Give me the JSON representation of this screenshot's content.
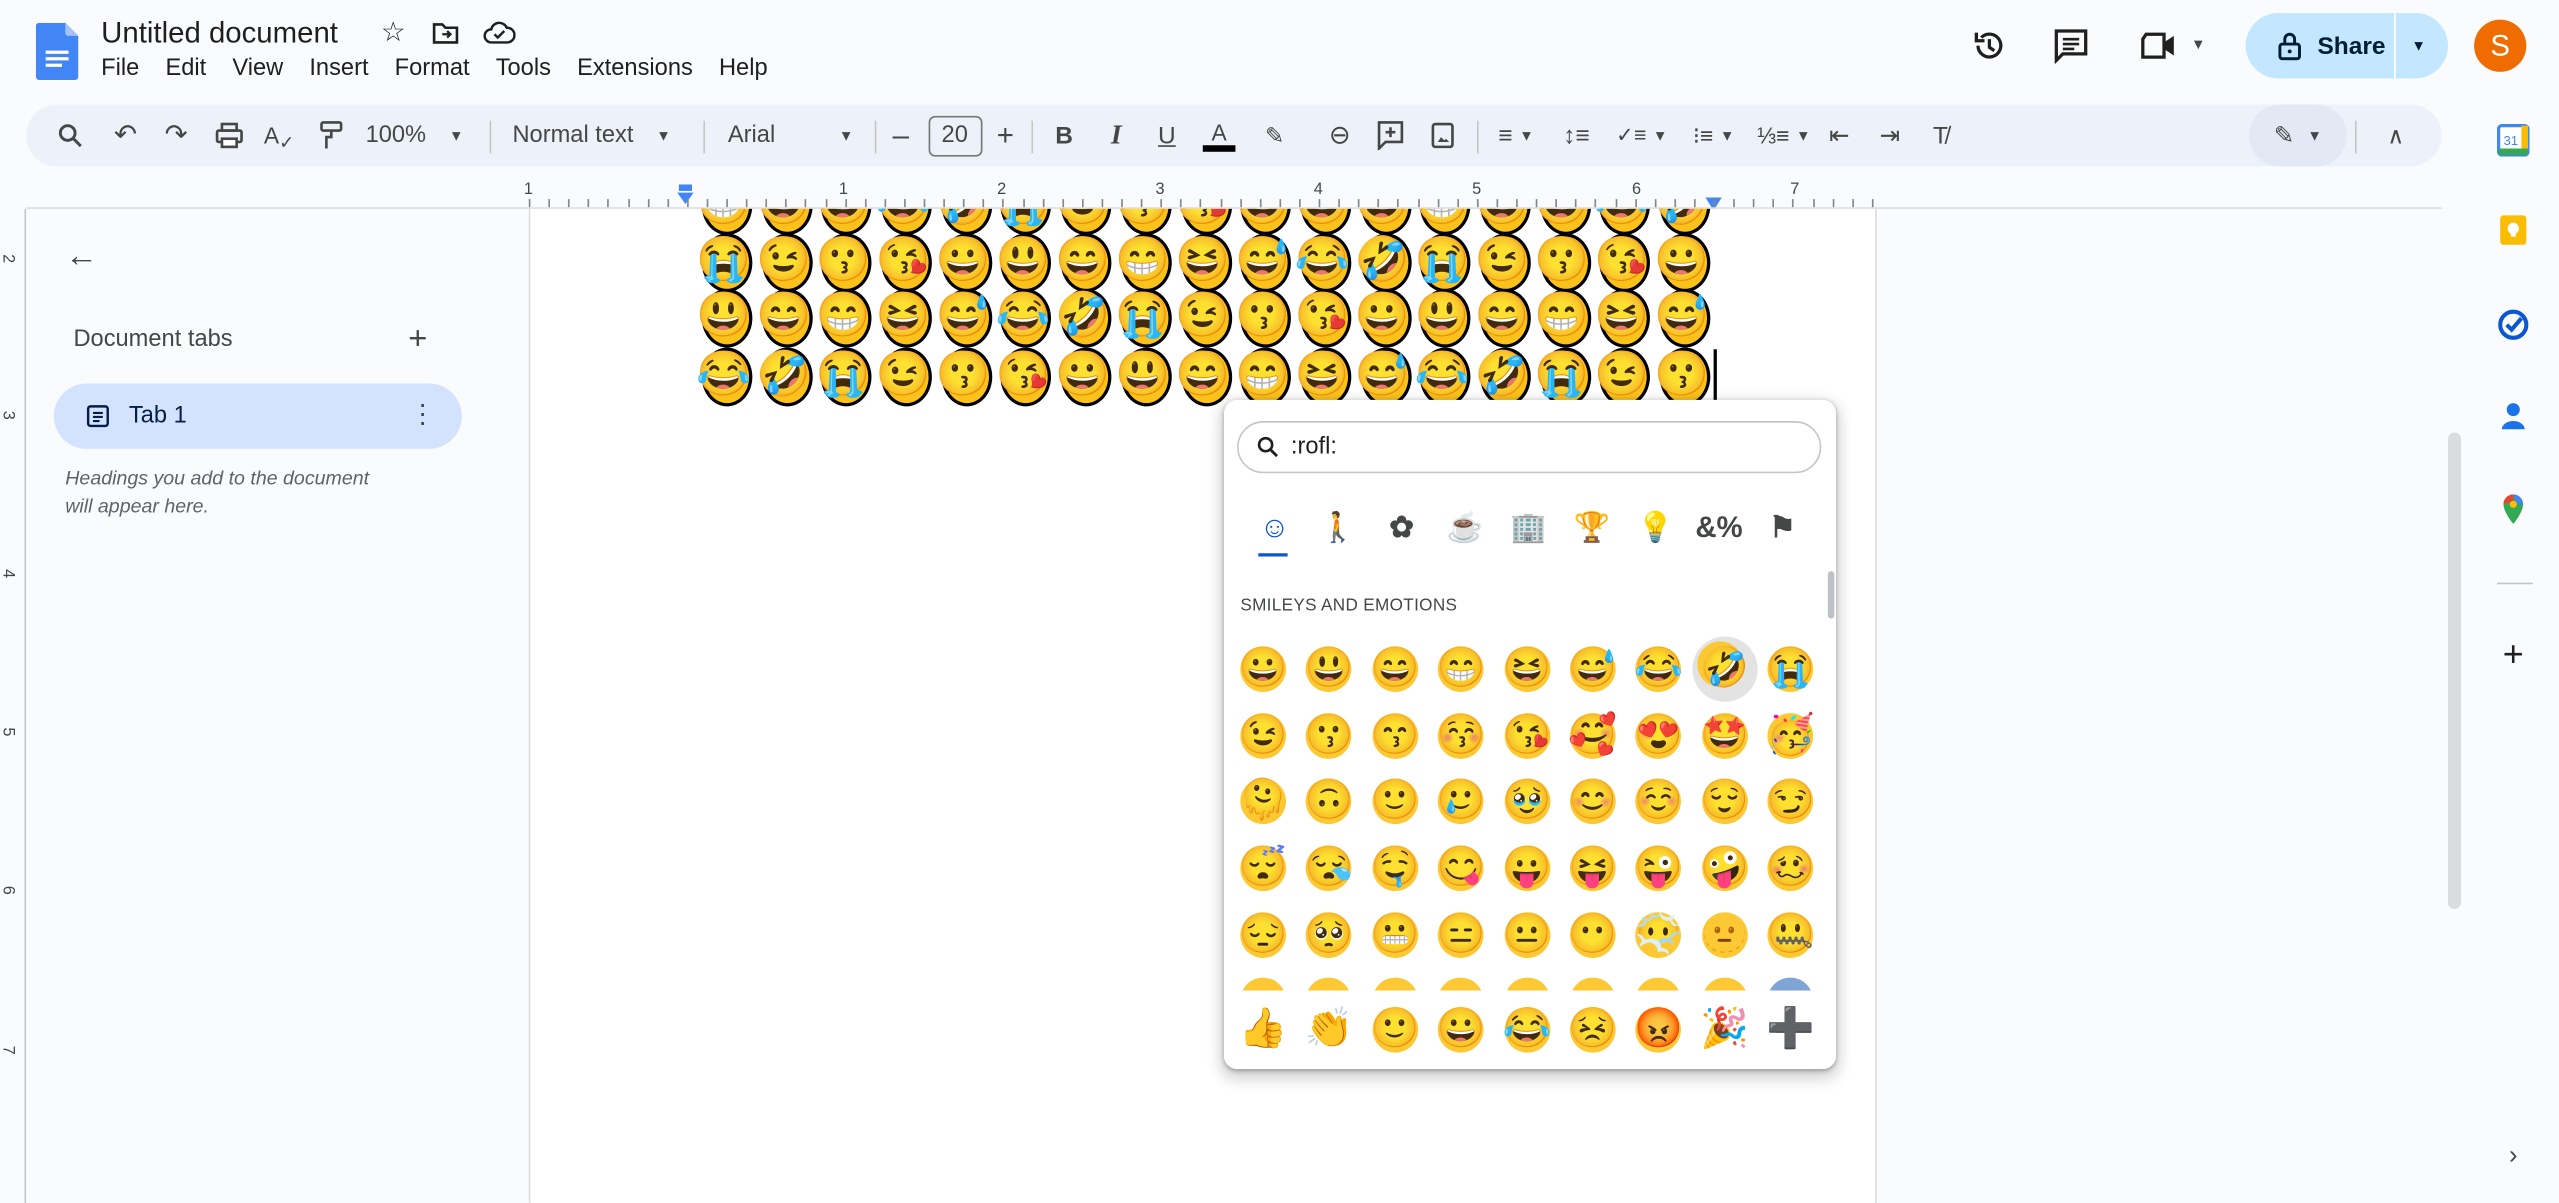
{
  "header": {
    "title": "Untitled document",
    "menu": [
      "File",
      "Edit",
      "View",
      "Insert",
      "Format",
      "Tools",
      "Extensions",
      "Help"
    ],
    "share_label": "Share",
    "avatar_initial": "S"
  },
  "toolbar": {
    "zoom": "100%",
    "style": "Normal text",
    "font": "Arial",
    "font_size": "20"
  },
  "ruler": {
    "horizontal": [
      "1",
      "1",
      "2",
      "3",
      "4",
      "5",
      "6",
      "7"
    ],
    "vertical": [
      "2",
      "3",
      "4",
      "5",
      "6",
      "7"
    ]
  },
  "sidebar": {
    "heading": "Document tabs",
    "tabs": [
      {
        "label": "Tab 1"
      }
    ],
    "hint_line1": "Headings you add to the document",
    "hint_line2": "will appear here."
  },
  "document": {
    "rows": [
      [
        "😁",
        "😆",
        "😅",
        "😂",
        "🤣",
        "😭",
        "😉",
        "😗",
        "😘",
        "😀",
        "😃",
        "😄",
        "😁",
        "😆",
        "😅",
        "😂",
        "🤣"
      ],
      [
        "😭",
        "😉",
        "😗",
        "😘",
        "😀",
        "😃",
        "😄",
        "😁",
        "😆",
        "😅",
        "😂",
        "🤣",
        "😭",
        "😉",
        "😗",
        "😘",
        "😀"
      ],
      [
        "😃",
        "😄",
        "😁",
        "😆",
        "😅",
        "😂",
        "🤣",
        "😭",
        "😉",
        "😗",
        "😘",
        "😀",
        "😃",
        "😄",
        "😁",
        "😆",
        "😅"
      ],
      [
        "😂",
        "🤣",
        "😭",
        "😉",
        "😗",
        "😘",
        "😀",
        "😃",
        "😄",
        "😁",
        "😆",
        "😅",
        "😂",
        "🤣",
        "😭",
        "😉",
        "😗"
      ]
    ]
  },
  "emoji_picker": {
    "search_value": ":rofl:",
    "categories": [
      "smileys-icon",
      "people-icon",
      "nature-icon",
      "food-icon",
      "travel-icon",
      "activities-icon",
      "objects-icon",
      "symbols-icon",
      "flags-icon"
    ],
    "active_category": "smileys-icon",
    "section_title": "SMILEYS AND EMOTIONS",
    "grid": [
      [
        "😀",
        "😃",
        "😄",
        "😁",
        "😆",
        "😅",
        "😂",
        "🤣",
        "😭"
      ],
      [
        "😉",
        "😗",
        "😙",
        "😚",
        "😘",
        "🥰",
        "😍",
        "🤩",
        "🥳"
      ],
      [
        "🫠",
        "🙃",
        "🙂",
        "🥲",
        "🥹",
        "😊",
        "☺️",
        "😌",
        "😏"
      ],
      [
        "😴",
        "😪",
        "🤤",
        "😋",
        "😛",
        "😝",
        "😜",
        "🤪",
        "🥴"
      ],
      [
        "😔",
        "🥺",
        "😬",
        "😑",
        "😐",
        "😶",
        "😶‍🌫️",
        "🫥",
        "🤐"
      ]
    ],
    "highlighted": "🤣",
    "recent": [
      "👍",
      "👏",
      "🙂",
      "😀",
      "😂",
      "😣",
      "😡",
      "🎉",
      "➕"
    ]
  },
  "colors": {
    "accent": "#0b57d0",
    "share_bg": "#c2e7ff",
    "tab_bg": "#d3e3fd",
    "avatar": "#ef6c00",
    "toolbar_bg": "#edf2fa"
  }
}
